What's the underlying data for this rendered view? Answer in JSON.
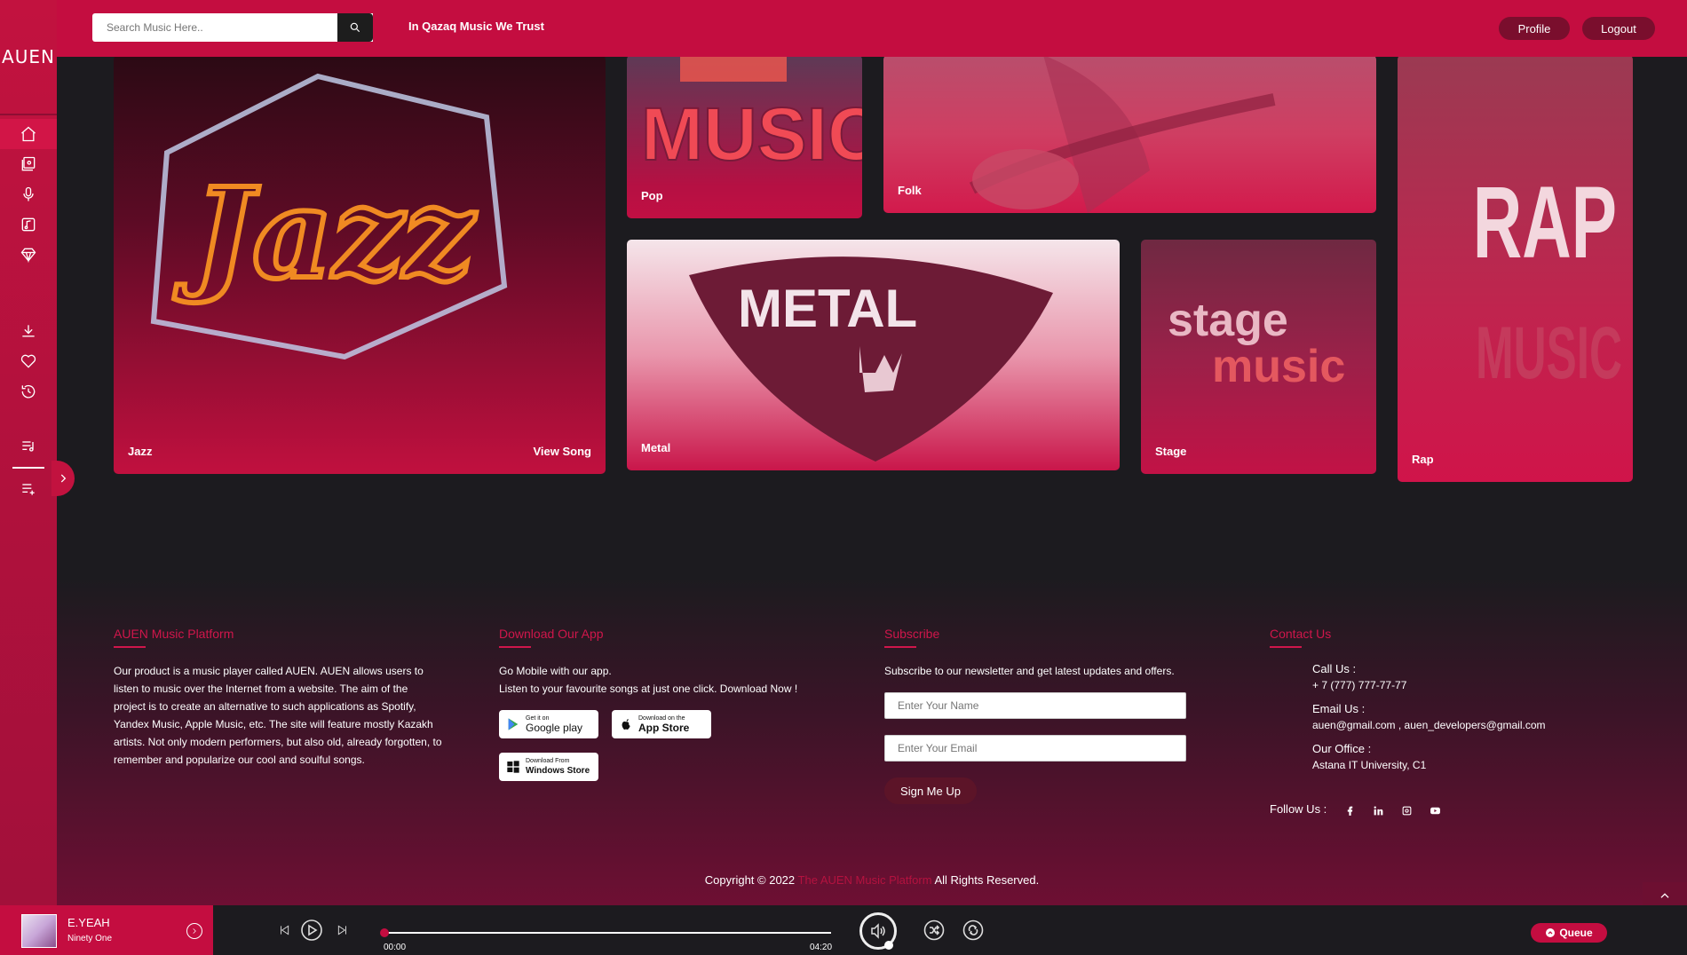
{
  "app": {
    "logo": "AUEN"
  },
  "header": {
    "search_placeholder": "Search Music Here..",
    "tagline": "In Qazaq Music We Trust",
    "profile_label": "Profile",
    "logout_label": "Logout"
  },
  "sidebar": {
    "items": [
      {
        "icon": "home-icon",
        "active": true
      },
      {
        "icon": "albums-icon"
      },
      {
        "icon": "microphone-icon"
      },
      {
        "icon": "music-note-icon"
      },
      {
        "icon": "diamond-icon"
      },
      {
        "icon": "download-icon"
      },
      {
        "icon": "heart-icon"
      },
      {
        "icon": "history-icon"
      },
      {
        "icon": "playlist-icon"
      },
      {
        "icon": "add-playlist-icon"
      }
    ]
  },
  "genres": {
    "jazz": {
      "label": "Jazz",
      "art": "Jazz",
      "action": "View Song"
    },
    "pop": {
      "label": "Pop",
      "art": "MUSIC"
    },
    "folk": {
      "label": "Folk"
    },
    "metal": {
      "label": "Metal",
      "art": "METAL"
    },
    "stage": {
      "label": "Stage",
      "art1": "stage",
      "art2": "music"
    },
    "rap": {
      "label": "Rap",
      "art1": "RAP",
      "art2": "MUSIC"
    }
  },
  "footer": {
    "about": {
      "title": "AUEN Music Platform",
      "text": "Our product is a music player called AUEN. AUEN allows users to listen to music over the Internet from a website. The aim of the project is to create an alternative to such applications as Spotify, Yandex Music, Apple Music, etc. The site will feature mostly Kazakh artists. Not only modern performers, but also old, already forgotten, to remember and popularize our cool and soulful songs."
    },
    "download": {
      "title": "Download Our App",
      "line1": "Go Mobile with our app.",
      "line2": "Listen to your favourite songs at just one click. Download Now !",
      "google_small": "Get it on",
      "google_big": "Google play",
      "apple_small": "Download on the",
      "apple_big": "App Store",
      "windows_small": "Download From",
      "windows_big": "Windows Store"
    },
    "subscribe": {
      "title": "Subscribe",
      "text": "Subscribe to our newsletter and get latest updates and offers.",
      "name_placeholder": "Enter Your Name",
      "email_placeholder": "Enter Your Email",
      "button": "Sign Me Up"
    },
    "contact": {
      "title": "Contact Us",
      "call_label": "Call Us :",
      "call_value": "+ 7 (777) 777-77-77",
      "email_label": "Email Us :",
      "email_value": "auen@gmail.com , auen_developers@gmail.com",
      "office_label": "Our Office :",
      "office_value": "Astana IT University, C1",
      "follow_label": "Follow Us :",
      "socials": [
        "facebook-icon",
        "linkedin-icon",
        "instagram-icon",
        "youtube-icon"
      ]
    },
    "copyright_prefix": "Copyright © 2022",
    "copyright_link": "The AUEN Music Platform",
    "copyright_suffix": "All Rights Reserved."
  },
  "player": {
    "title": "E.YEAH",
    "artist": "Ninety One",
    "current_time": "00:00",
    "duration": "04:20",
    "progress": 0,
    "queue_label": "Queue"
  },
  "colors": {
    "accent": "#c40d40",
    "dark": "#1c1b1f",
    "brand_red": "#d0164b"
  }
}
